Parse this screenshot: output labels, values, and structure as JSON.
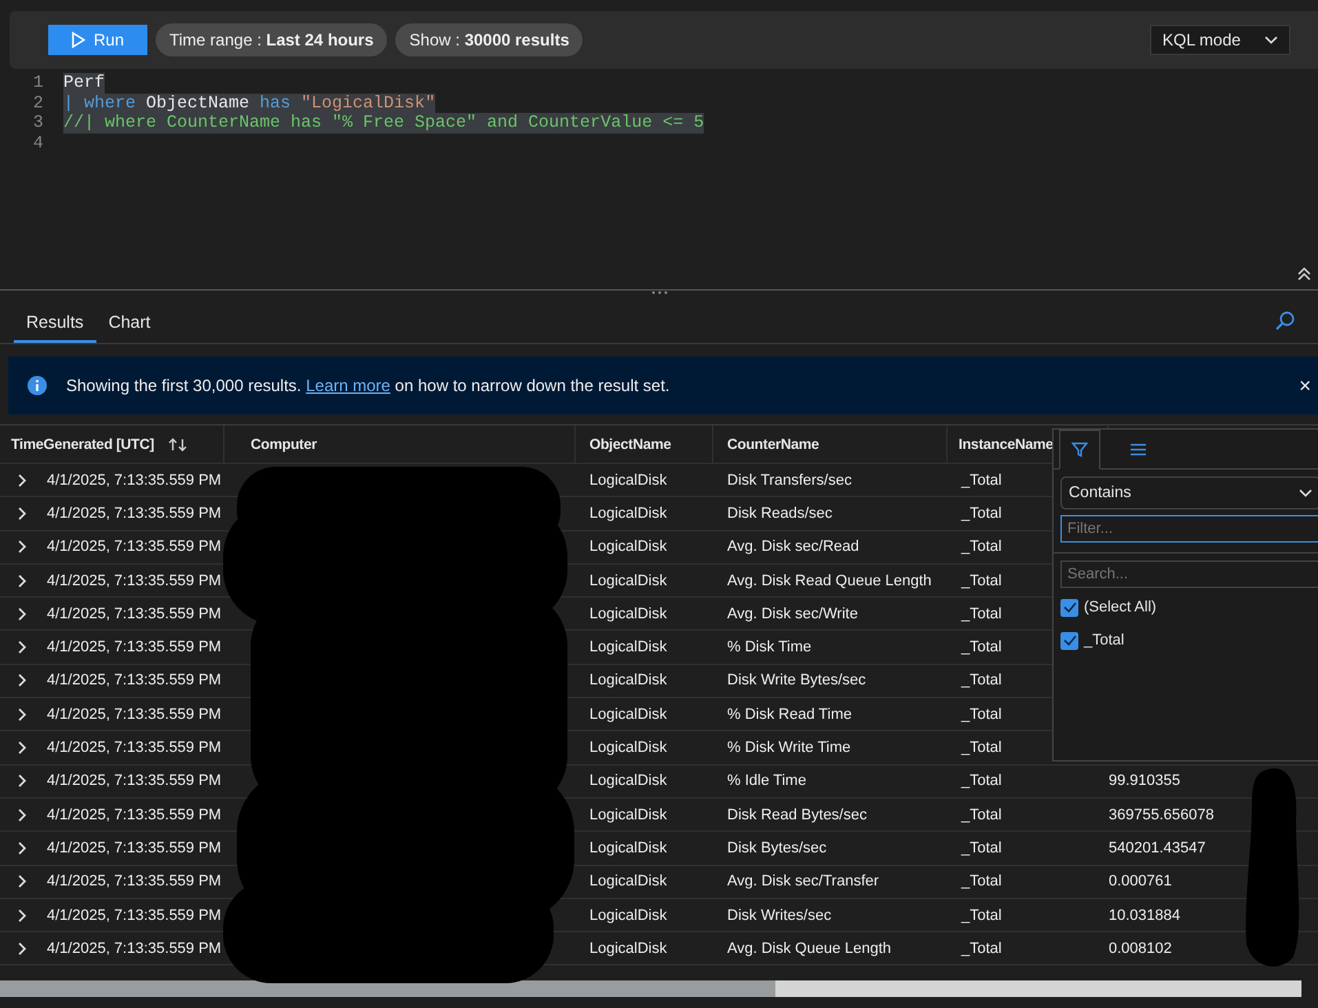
{
  "toolbar": {
    "run_button": "Run",
    "time_range": "Time range :  **Last 24 hours**",
    "show": "Show : **30000 results**",
    "mode_dropdown": "KQL mode"
  },
  "editor": {
    "lines": [
      {
        "number": "1",
        "selected": true,
        "tokens": [
          {
            "kind": "plain",
            "text": "Perf"
          }
        ]
      },
      {
        "number": "2",
        "selected": true,
        "tokens": [
          {
            "kind": "keyword",
            "text": "| where"
          },
          {
            "kind": "plain",
            "text": " ObjectName "
          },
          {
            "kind": "keyword",
            "text": "has"
          },
          {
            "kind": "string",
            "text": " \"LogicalDisk\""
          }
        ]
      },
      {
        "number": "3",
        "selected": true,
        "tokens": [
          {
            "kind": "comment",
            "text": "//| where CounterName has \"% Free Space\" and CounterValue <= 5"
          }
        ]
      },
      {
        "number": "4"
      }
    ]
  },
  "result_tabs": [
    {
      "label": "Results",
      "selected": true
    },
    {
      "label": "Chart",
      "selected": false
    }
  ],
  "banner": {
    "text_before": "Showing the first 30,000 results.",
    "link": "Learn more",
    "text_after": "on how to narrow down the result set.",
    "close": "×"
  },
  "table": {
    "columns": [
      "TimeGenerated [UTC]",
      "Computer",
      "ObjectName",
      "CounterName",
      "InstanceName"
    ],
    "rows": [
      {
        "time": "4/1/2025, 7:13:35.559 PM",
        "object": "LogicalDisk",
        "counter": "Disk Transfers/sec",
        "instance": "_Total"
      },
      {
        "time": "4/1/2025, 7:13:35.559 PM",
        "object": "LogicalDisk",
        "counter": "Disk Reads/sec",
        "instance": "_Total"
      },
      {
        "time": "4/1/2025, 7:13:35.559 PM",
        "object": "LogicalDisk",
        "counter": "Avg. Disk sec/Read",
        "instance": "_Total"
      },
      {
        "time": "4/1/2025, 7:13:35.559 PM",
        "object": "LogicalDisk",
        "counter": "Avg. Disk Read Queue Length",
        "instance": "_Total"
      },
      {
        "time": "4/1/2025, 7:13:35.559 PM",
        "object": "LogicalDisk",
        "counter": "Avg. Disk sec/Write",
        "instance": "_Total"
      },
      {
        "time": "4/1/2025, 7:13:35.559 PM",
        "object": "LogicalDisk",
        "counter": "% Disk Time",
        "instance": "_Total"
      },
      {
        "time": "4/1/2025, 7:13:35.559 PM",
        "object": "LogicalDisk",
        "counter": "Disk Write Bytes/sec",
        "instance": "_Total"
      },
      {
        "time": "4/1/2025, 7:13:35.559 PM",
        "object": "LogicalDisk",
        "counter": "% Disk Read Time",
        "instance": "_Total"
      },
      {
        "time": "4/1/2025, 7:13:35.559 PM",
        "object": "LogicalDisk",
        "counter": "% Disk Write Time",
        "instance": "_Total"
      },
      {
        "time": "4/1/2025, 7:13:35.559 PM",
        "object": "LogicalDisk",
        "counter": "% Idle Time",
        "instance": "_Total",
        "value": "99.910355"
      },
      {
        "time": "4/1/2025, 7:13:35.559 PM",
        "object": "LogicalDisk",
        "counter": "Disk Read Bytes/sec",
        "instance": "_Total",
        "value": "369755.656078"
      },
      {
        "time": "4/1/2025, 7:13:35.559 PM",
        "object": "LogicalDisk",
        "counter": "Disk Bytes/sec",
        "instance": "_Total",
        "value": "540201.43547"
      },
      {
        "time": "4/1/2025, 7:13:35.559 PM",
        "object": "LogicalDisk",
        "counter": "Avg. Disk sec/Transfer",
        "instance": "_Total",
        "value": "0.000761"
      },
      {
        "time": "4/1/2025, 7:13:35.559 PM",
        "object": "LogicalDisk",
        "counter": "Disk Writes/sec",
        "instance": "_Total",
        "value": "10.031884"
      },
      {
        "time": "4/1/2025, 7:13:35.559 PM",
        "object": "LogicalDisk",
        "counter": "Avg. Disk Queue Length",
        "instance": "_Total",
        "value": "0.008102"
      }
    ]
  },
  "filter_popup": {
    "tabs": [
      {
        "kind": "filter",
        "selected": true
      },
      {
        "kind": "columns",
        "selected": false
      }
    ],
    "operator": "Contains",
    "filter_placeholder": "Filter...",
    "search_placeholder": "Search...",
    "options": [
      {
        "label": "(Select All)",
        "checked": true
      },
      {
        "label": "_Total",
        "checked": true
      }
    ]
  }
}
